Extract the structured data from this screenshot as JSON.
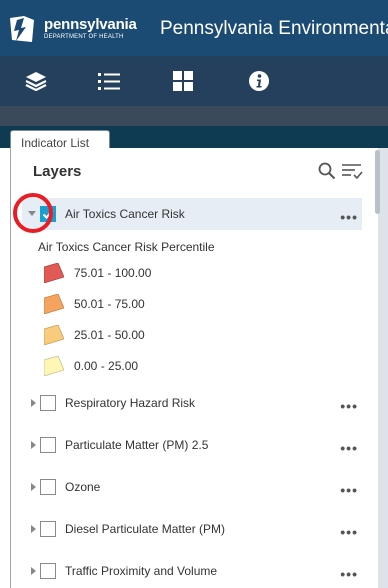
{
  "header": {
    "logo_line1": "pennsylvania",
    "logo_line2": "DEPARTMENT OF HEALTH",
    "title": "Pennsylvania Environmental"
  },
  "toolbar": {
    "buttons": [
      "layers-icon",
      "list-icon",
      "grid-icon",
      "info-icon"
    ]
  },
  "tab": {
    "label": "Indicator List"
  },
  "panel": {
    "title": "Layers",
    "active_layer": {
      "label": "Air Toxics Cancer Risk",
      "checked": true,
      "expanded": true,
      "legend_title": "Air Toxics Cancer Risk Percentile",
      "legend": [
        {
          "label": "75.01 - 100.00",
          "color": "#e05a56"
        },
        {
          "label": "50.01 - 75.00",
          "color": "#f4a460"
        },
        {
          "label": "25.01 - 50.00",
          "color": "#f9cc7d"
        },
        {
          "label": "0.00 - 25.00",
          "color": "#fdf6b5"
        }
      ]
    },
    "layers": [
      {
        "label": "Respiratory Hazard Risk",
        "checked": false
      },
      {
        "label": "Particulate Matter (PM) 2.5",
        "checked": false
      },
      {
        "label": "Ozone",
        "checked": false
      },
      {
        "label": "Diesel Particulate Matter (PM)",
        "checked": false
      },
      {
        "label": "Traffic Proximity and Volume",
        "checked": false
      }
    ],
    "more_label": "•••"
  },
  "colors": {
    "header_bg": "#1b4b73",
    "toolbar_bg": "#24405c",
    "checkbox_checked": "#1a9fd4",
    "highlight_circle": "#ea1c24"
  }
}
